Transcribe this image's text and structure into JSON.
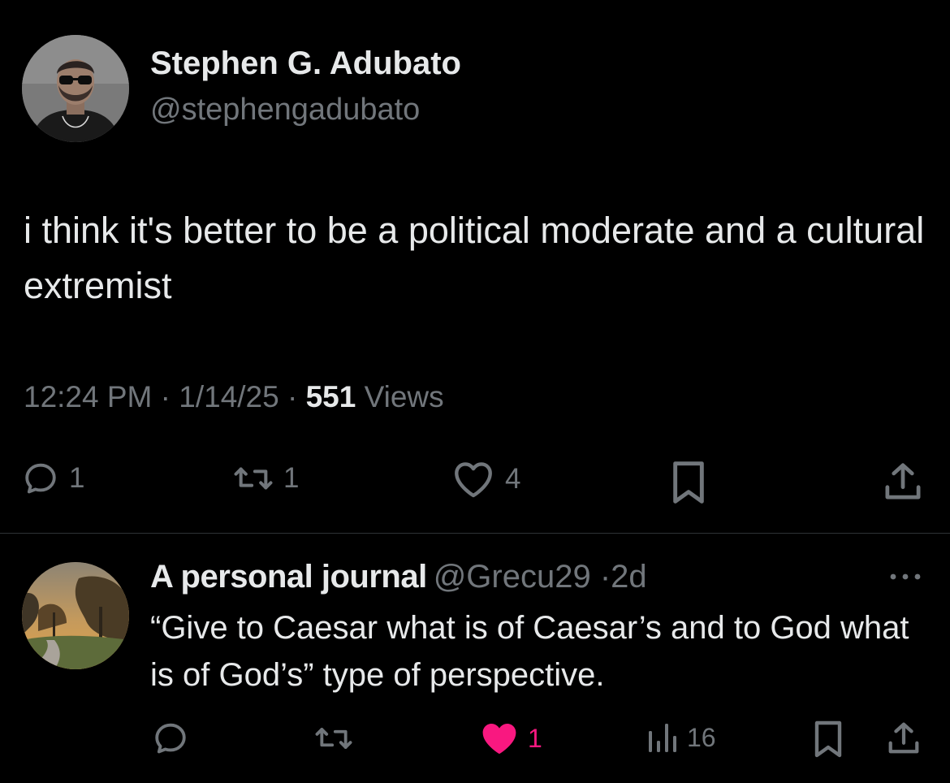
{
  "tweet": {
    "author_name": "Stephen G. Adubato",
    "author_handle": "@stephengadubato",
    "text": "i think it's better to be a political moderate and a cultural extremist",
    "time": "12:24 PM",
    "date": "1/14/25",
    "separator": "·",
    "views_count": "551",
    "views_label": "Views",
    "actions": {
      "reply": {
        "icon": "reply-icon",
        "count": "1"
      },
      "retweet": {
        "icon": "retweet-icon",
        "count": "1"
      },
      "like": {
        "icon": "heart-icon",
        "count": "4"
      },
      "bookmark": {
        "icon": "bookmark-icon"
      },
      "share": {
        "icon": "share-icon"
      }
    }
  },
  "reply": {
    "author_name": "A personal journal",
    "author_handle": "@Grecu29",
    "separator": "·",
    "time_ago": "2d",
    "text": "“Give to Caesar what is of Caesar’s and to God what is of God’s” type of perspective.",
    "actions": {
      "reply": {
        "icon": "reply-icon"
      },
      "retweet": {
        "icon": "retweet-icon"
      },
      "like": {
        "icon": "heart-filled-icon",
        "count": "1",
        "liked": true
      },
      "views": {
        "icon": "analytics-icon",
        "count": "16"
      },
      "bookmark": {
        "icon": "bookmark-icon"
      },
      "share": {
        "icon": "share-icon"
      }
    }
  },
  "colors": {
    "background": "#000000",
    "primary_text": "#e7e9ea",
    "secondary_text": "#71767b",
    "divider": "#2f3336",
    "like_pink": "#f91880"
  }
}
